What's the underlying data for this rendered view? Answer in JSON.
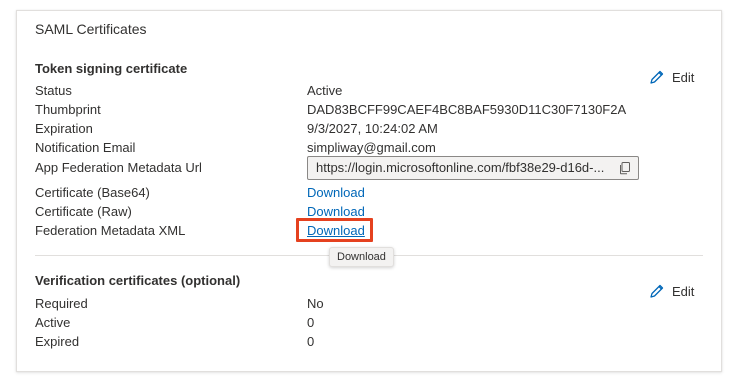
{
  "card": {
    "title": "SAML Certificates"
  },
  "token_section": {
    "title": "Token signing certificate",
    "edit_label": "Edit",
    "rows": [
      {
        "label": "Status",
        "value": "Active"
      },
      {
        "label": "Thumbprint",
        "value": "DAD83BCFF99CAEF4BC8BAF5930D11C30F7130F2A"
      },
      {
        "label": "Expiration",
        "value": "9/3/2027, 10:24:02 AM"
      },
      {
        "label": "Notification Email",
        "value": "simpliway@gmail.com"
      },
      {
        "label": "App Federation Metadata Url",
        "value": "https://login.microsoftonline.com/fbf38e29-d16d-..."
      },
      {
        "label": "Certificate (Base64)",
        "value": "Download"
      },
      {
        "label": "Certificate (Raw)",
        "value": "Download"
      },
      {
        "label": "Federation Metadata XML",
        "value": "Download"
      }
    ]
  },
  "tooltip": {
    "text": "Download"
  },
  "verification_section": {
    "title": "Verification certificates (optional)",
    "edit_label": "Edit",
    "rows": [
      {
        "label": "Required",
        "value": "No"
      },
      {
        "label": "Active",
        "value": "0"
      },
      {
        "label": "Expired",
        "value": "0"
      }
    ]
  },
  "colors": {
    "link": "#0067b8",
    "highlight": "#e5411f",
    "text": "#323130",
    "border": "#e1dfdd"
  },
  "icons": {
    "edit": "pencil-icon",
    "copy": "copy-icon"
  }
}
